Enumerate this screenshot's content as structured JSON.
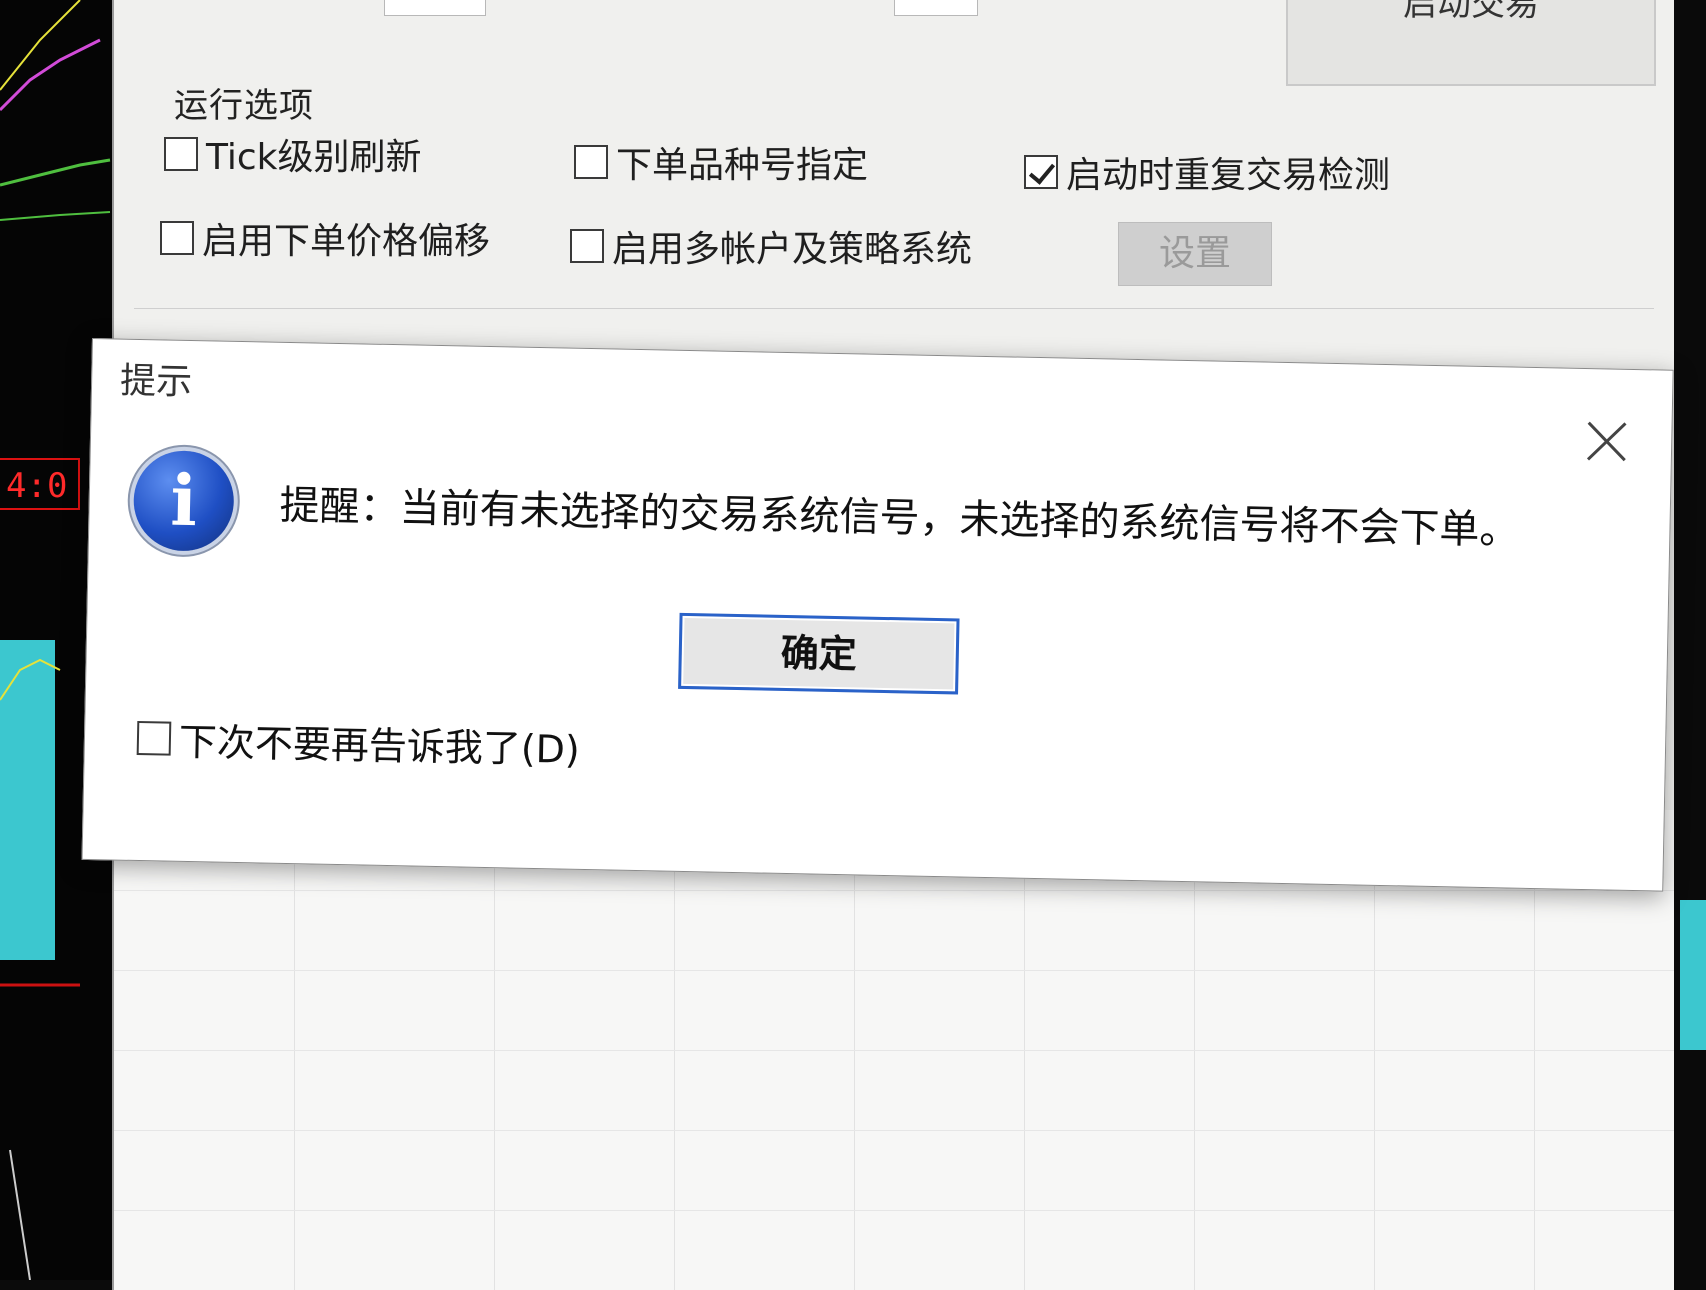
{
  "background": {
    "time_readout": "4:0"
  },
  "main_window": {
    "start_button_label": "启动交易",
    "run_options": {
      "title": "运行选项",
      "options": [
        {
          "label": "Tick级别刷新",
          "checked": false
        },
        {
          "label": "下单品种号指定",
          "checked": false
        },
        {
          "label": "启动时重复交易检测",
          "checked": true
        },
        {
          "label": "启用下单价格偏移",
          "checked": false
        },
        {
          "label": "启用多帐户及策略系统",
          "checked": false
        }
      ],
      "settings_button_label": "设置"
    }
  },
  "dialog": {
    "title": "提示",
    "message": "提醒：当前有未选择的交易系统信号，未选择的系统信号将不会下单。",
    "ok_label": "确定",
    "dont_tell_label": "下次不要再告诉我了(D)",
    "dont_tell_checked": false
  },
  "colors": {
    "ok_border": "#2a62c9",
    "info_icon": "#1f4fc4",
    "time_readout": "#ff2a2a"
  }
}
